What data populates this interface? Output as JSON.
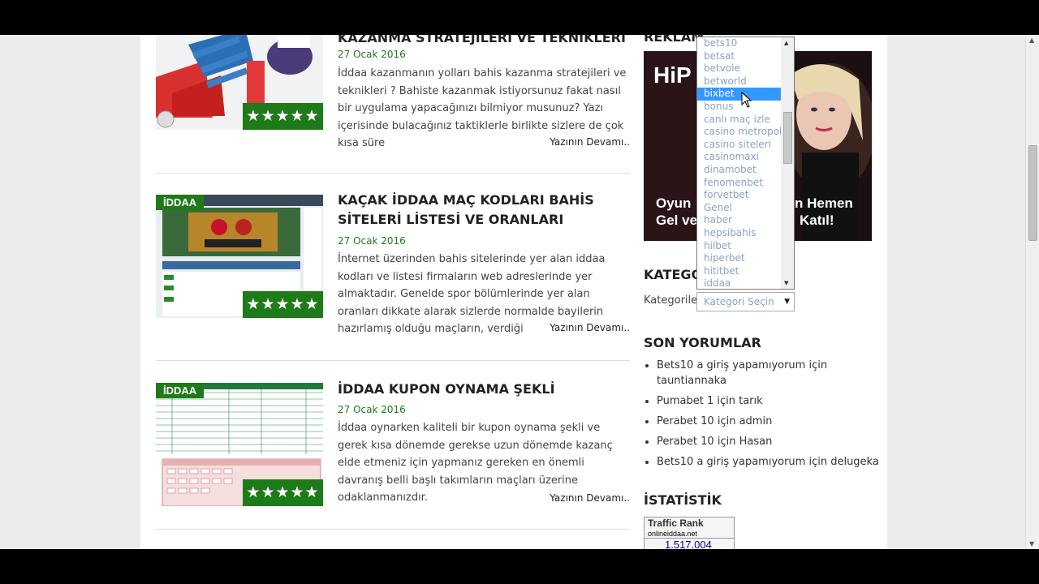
{
  "posts": [
    {
      "title": "KAZANMA STRATEJİLERİ VE TEKNİKLERİ",
      "date": "27 Ocak 2016",
      "excerpt": "İddaa kazanmanın yolları bahis kazanma stratejileri ve teknikleri ? Bahiste kazanmak istiyorsunuz fakat nasıl bir uygulama yapacağınızı bilmiyor musunuz? Yazı içerisinde bulacağınız taktiklerle birlikte sizlere de çok kısa süre",
      "more": "Yazının Devamı..",
      "stars": "★★★★★"
    },
    {
      "title": "KAÇAK İDDAA MAÇ KODLARI BAHİS SİTELERİ LİSTESİ VE ORANLARI",
      "date": "27 Ocak 2016",
      "excerpt": "İnternet üzerinden bahis sitelerinde yer alan iddaa kodları ve listesi firmaların web adreslerinde yer almaktadır. Genelde spor bölümlerinde yer alan oranları dikkate alarak sizlerde normalde bayilerin hazırlamış olduğu maçların, verdiği",
      "more": "Yazının Devamı..",
      "tag": "İDDAA",
      "stars": "★★★★★"
    },
    {
      "title": "İDDAA KUPON OYNAMA ŞEKLİ",
      "date": "27 Ocak 2016",
      "excerpt": "İddaa oynarken kaliteli bir kupon oynama şekli ve gerek kısa dönemde gerekse uzun dönemde kazanç elde etmeniz için yapmanız gereken en önemli davranış belli başlı takımların maçları üzerine odaklanmanızdır.",
      "more": "Yazının Devamı..",
      "tag": "İDDAA",
      "stars": "★★★★★"
    }
  ],
  "sidebar": {
    "reklam_title": "REKLAM",
    "ad": {
      "brand": "HiP",
      "line1": "Oyun",
      "line1b": "n Hemen",
      "line2": "Gel ve",
      "line2b": "Katıl!"
    },
    "kategori_title": "KATEGORİLER",
    "kategori_label": "Kategoriler",
    "select_value": "Kategori Seçin",
    "dropdown_options": [
      "bets10",
      "betsat",
      "betvole",
      "betworld",
      "bixbet",
      "bonus",
      "canlı maç izle",
      "casino metropol",
      "casino siteleri",
      "casinomaxi",
      "dinamobet",
      "fenomenbet",
      "forvetbet",
      "Genel",
      "haber",
      "hepsibahis",
      "hilbet",
      "hiperbet",
      "hititbet",
      "iddaa"
    ],
    "selected_option": "bixbet",
    "son_yorumlar_title": "SON YORUMLAR",
    "comments": [
      "Bets10 a giriş yapamıyorum için tauntiannaka",
      "Pumabet 1 için tarık",
      "Perabet 10 için admin",
      "Perabet 10 için Hasan",
      "Bets10 a giriş yapamıyorum için delugeka"
    ],
    "istatistik_title": "İSTATİSTİK",
    "traffic": {
      "label": "Traffic Rank",
      "site": "onlineiddaa.net",
      "rank": "1.517.004"
    }
  },
  "colors": {
    "accent": "#1f7a1a",
    "selection": "#3399ff"
  }
}
